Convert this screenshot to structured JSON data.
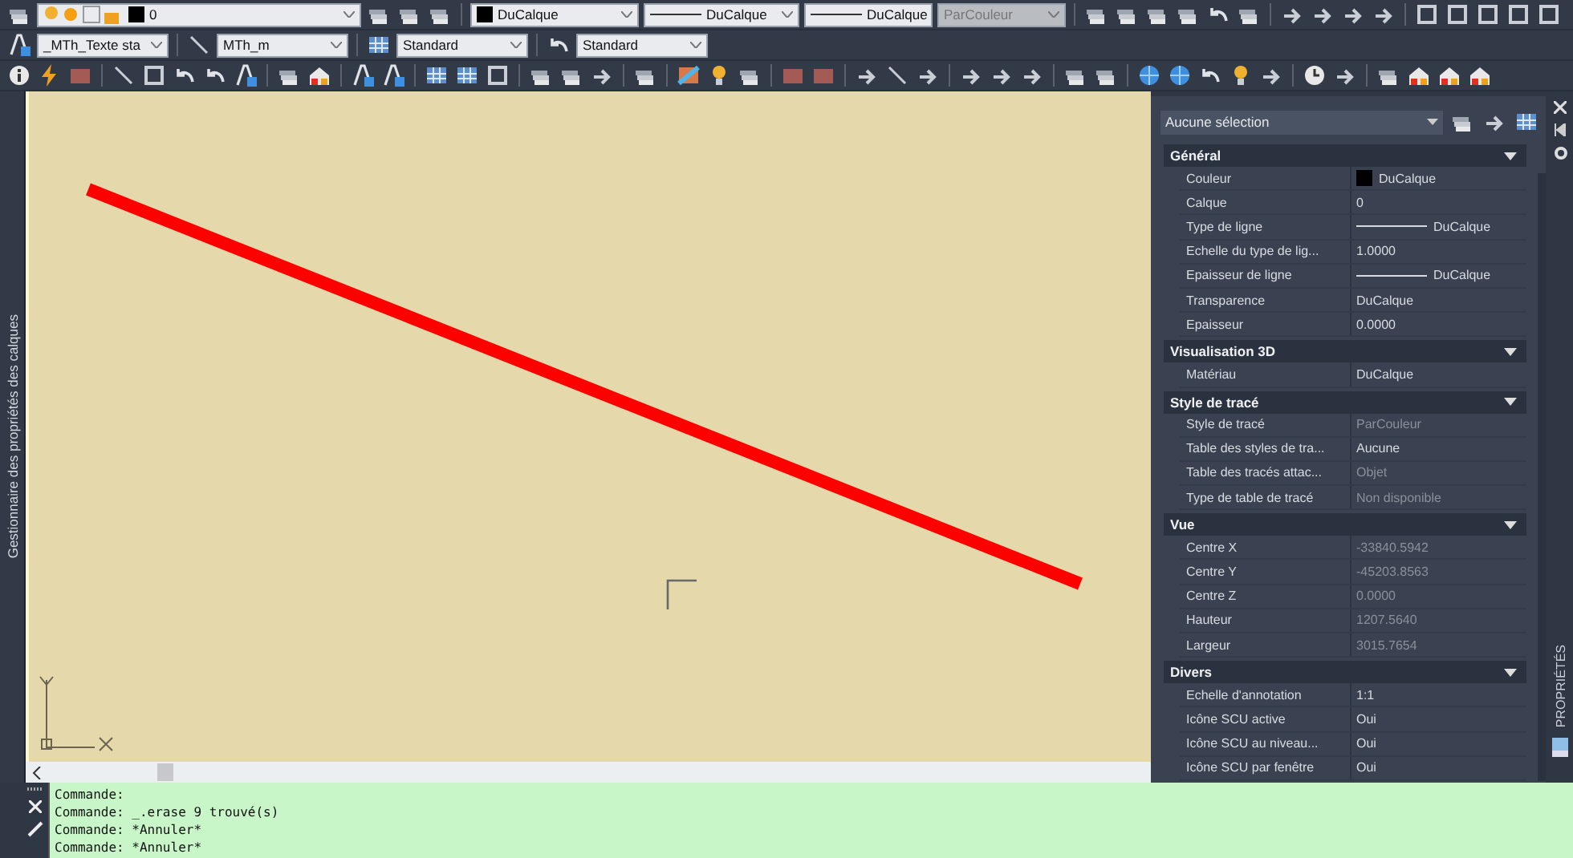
{
  "layer_dropdown": {
    "value": "0"
  },
  "property_dropdowns": [
    {
      "kind": "color",
      "value": "DuCalque",
      "disabled": false
    },
    {
      "kind": "linetype",
      "value": "DuCalque",
      "disabled": false
    },
    {
      "kind": "lineweight",
      "value": "DuCalque",
      "disabled": false
    },
    {
      "kind": "plain",
      "value": "ParCouleur",
      "disabled": true
    }
  ],
  "style_dropdowns": [
    {
      "kind": "text",
      "value": "_MTh_Texte sta"
    },
    {
      "kind": "dimension",
      "value": "MTh_m"
    },
    {
      "kind": "table",
      "value": "Standard"
    },
    {
      "kind": "multileader",
      "value": "Standard"
    }
  ],
  "left_palette": {
    "title": "Gestionnaire des propriétés des calques"
  },
  "properties": {
    "selection": "Aucune sélection",
    "palette_title": "PROPRIÉTÉS",
    "sections": [
      {
        "title": "Général",
        "expanded": true,
        "rows": [
          {
            "label": "Couleur",
            "value": "DuCalque",
            "kind": "color",
            "disabled": false
          },
          {
            "label": "Calque",
            "value": "0",
            "kind": "text",
            "disabled": false
          },
          {
            "label": "Type de ligne",
            "value": "DuCalque",
            "kind": "line",
            "disabled": false
          },
          {
            "label": "Echelle du type de lig...",
            "value": "1.0000",
            "kind": "text",
            "disabled": false
          },
          {
            "label": "Epaisseur de ligne",
            "value": "DuCalque",
            "kind": "line",
            "disabled": false
          },
          {
            "label": "Transparence",
            "value": "DuCalque",
            "kind": "text",
            "disabled": false
          },
          {
            "label": "Epaisseur",
            "value": "0.0000",
            "kind": "text",
            "disabled": false
          }
        ]
      },
      {
        "title": "Visualisation 3D",
        "expanded": true,
        "rows": [
          {
            "label": "Matériau",
            "value": "DuCalque",
            "kind": "text",
            "disabled": false
          }
        ]
      },
      {
        "title": "Style de tracé",
        "expanded": true,
        "rows": [
          {
            "label": "Style de tracé",
            "value": "ParCouleur",
            "kind": "text",
            "disabled": true
          },
          {
            "label": "Table des styles de tra...",
            "value": "Aucune",
            "kind": "text",
            "disabled": false
          },
          {
            "label": "Table des tracés attac...",
            "value": "Objet",
            "kind": "text",
            "disabled": true
          },
          {
            "label": "Type de table de tracé",
            "value": "Non disponible",
            "kind": "text",
            "disabled": true
          }
        ]
      },
      {
        "title": "Vue",
        "expanded": true,
        "rows": [
          {
            "label": "Centre X",
            "value": "-33840.5942",
            "kind": "text",
            "disabled": true
          },
          {
            "label": "Centre Y",
            "value": "-45203.8563",
            "kind": "text",
            "disabled": true
          },
          {
            "label": "Centre Z",
            "value": "0.0000",
            "kind": "text",
            "disabled": true
          },
          {
            "label": "Hauteur",
            "value": "1207.5640",
            "kind": "text",
            "disabled": true
          },
          {
            "label": "Largeur",
            "value": "3015.7654",
            "kind": "text",
            "disabled": true
          }
        ]
      },
      {
        "title": "Divers",
        "expanded": true,
        "rows": [
          {
            "label": "Echelle d'annotation",
            "value": "1:1",
            "kind": "text",
            "disabled": false
          },
          {
            "label": "Icône SCU active",
            "value": "Oui",
            "kind": "text",
            "disabled": false
          },
          {
            "label": "Icône SCU au niveau...",
            "value": "Oui",
            "kind": "text",
            "disabled": false
          },
          {
            "label": "Icône SCU par fenêtre",
            "value": "Oui",
            "kind": "text",
            "disabled": false
          }
        ]
      }
    ]
  },
  "command_history": [
    "Commande:",
    "Commande: _.erase 9 trouvé(s)",
    "Commande: *Annuler*",
    "Commande: *Annuler*"
  ]
}
